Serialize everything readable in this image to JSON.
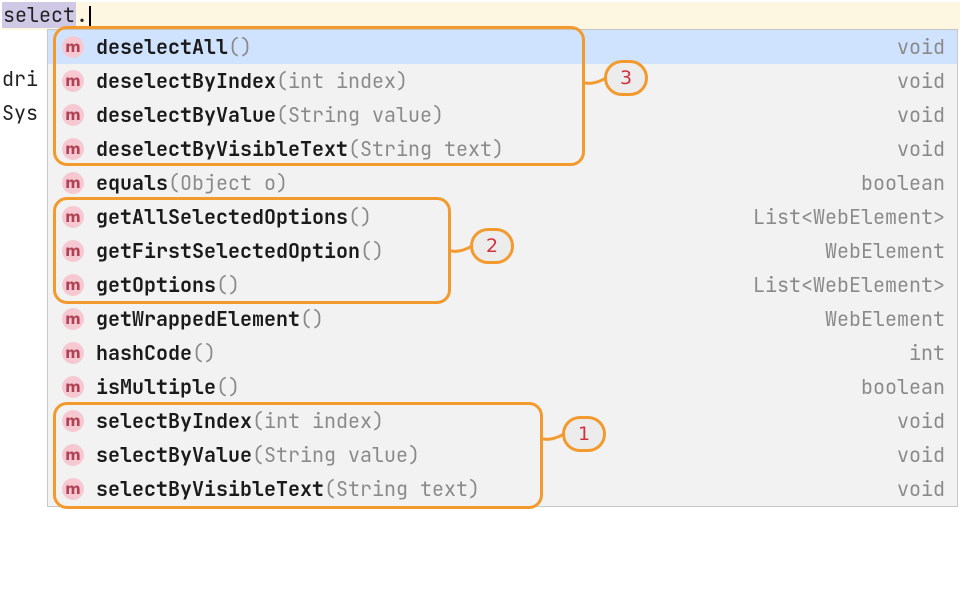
{
  "editor": {
    "typed_prefix": "select",
    "dot": "."
  },
  "background_words": {
    "dri": "dri",
    "sys": "Sys"
  },
  "completion_items": [
    {
      "name": "deselectAll",
      "params": "()",
      "ret": "void",
      "selected": true
    },
    {
      "name": "deselectByIndex",
      "params": "(int index)",
      "ret": "void",
      "selected": false
    },
    {
      "name": "deselectByValue",
      "params": "(String value)",
      "ret": "void",
      "selected": false
    },
    {
      "name": "deselectByVisibleText",
      "params": "(String text)",
      "ret": "void",
      "selected": false
    },
    {
      "name": "equals",
      "params": "(Object o)",
      "ret": "boolean",
      "selected": false
    },
    {
      "name": "getAllSelectedOptions",
      "params": "()",
      "ret": "List<WebElement>",
      "selected": false
    },
    {
      "name": "getFirstSelectedOption",
      "params": "()",
      "ret": "WebElement",
      "selected": false
    },
    {
      "name": "getOptions",
      "params": "()",
      "ret": "List<WebElement>",
      "selected": false
    },
    {
      "name": "getWrappedElement",
      "params": "()",
      "ret": "WebElement",
      "selected": false
    },
    {
      "name": "hashCode",
      "params": "()",
      "ret": "int",
      "selected": false
    },
    {
      "name": "isMultiple",
      "params": "()",
      "ret": "boolean",
      "selected": false
    },
    {
      "name": "selectByIndex",
      "params": "(int index)",
      "ret": "void",
      "selected": false
    },
    {
      "name": "selectByValue",
      "params": "(String value)",
      "ret": "void",
      "selected": false
    },
    {
      "name": "selectByVisibleText",
      "params": "(String text)",
      "ret": "void",
      "selected": false
    }
  ],
  "callouts": {
    "c1": "1",
    "c2": "2",
    "c3": "3"
  },
  "icon_letter": "m"
}
